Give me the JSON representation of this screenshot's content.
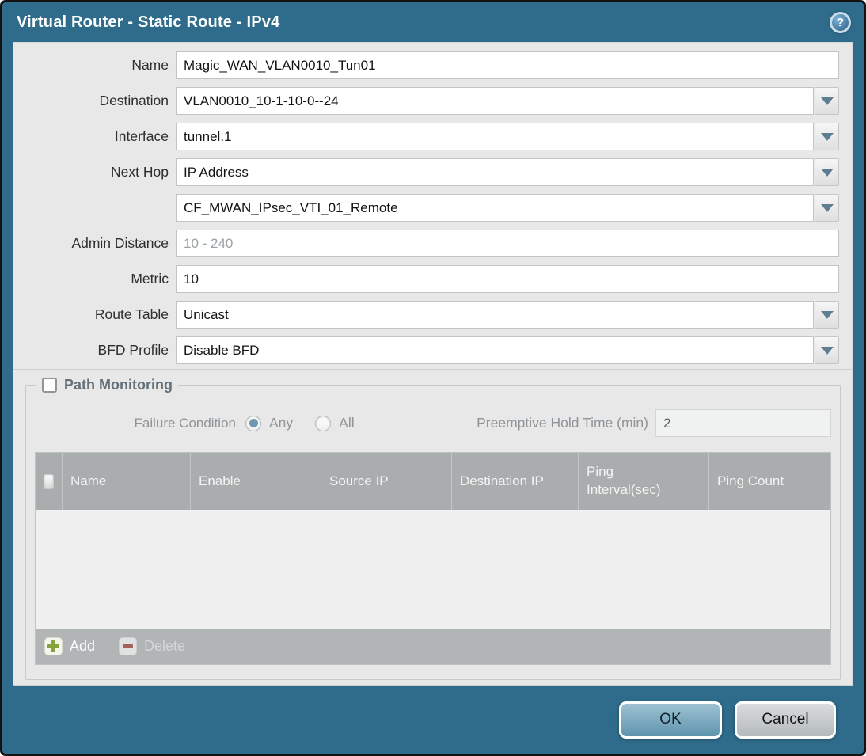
{
  "dialog": {
    "title": "Virtual Router - Static Route - IPv4",
    "icons": {
      "help_icon": "question-mark-circle",
      "help_glyph": "?",
      "dropdown_icon": "chevron-down-triangle",
      "add_icon": "green-plus",
      "delete_icon": "red-minus"
    },
    "colors": {
      "titlebar_teal": "#2f6c8b",
      "content_bg": "#e8e8e8",
      "table_header_bg": "#a9adad",
      "toolbar_bg": "#b1b5b5",
      "ok_button": "#6f9fb8",
      "cancel_button": "#bdc1c4",
      "selected_radio": "#6e99ad",
      "add_plus_green": "#86a23c",
      "delete_minus_red": "#a4544e"
    }
  },
  "form": {
    "name": {
      "label": "Name",
      "value": "Magic_WAN_VLAN0010_Tun01"
    },
    "destination": {
      "label": "Destination",
      "value": "VLAN0010_10-1-10-0--24"
    },
    "interface": {
      "label": "Interface",
      "value": "tunnel.1"
    },
    "next_hop": {
      "label": "Next Hop",
      "value": "IP Address"
    },
    "next_hop_address": {
      "value": "CF_MWAN_IPsec_VTI_01_Remote"
    },
    "admin_distance": {
      "label": "Admin Distance",
      "value": "",
      "placeholder": "10 - 240"
    },
    "metric": {
      "label": "Metric",
      "value": "10"
    },
    "route_table": {
      "label": "Route Table",
      "value": "Unicast"
    },
    "bfd_profile": {
      "label": "BFD Profile",
      "value": "Disable BFD"
    }
  },
  "path_monitoring": {
    "title": "Path Monitoring",
    "enabled": false,
    "failure_condition": {
      "label": "Failure Condition",
      "options": [
        {
          "label": "Any",
          "selected": true
        },
        {
          "label": "All",
          "selected": false
        }
      ]
    },
    "preemptive_hold_time": {
      "label": "Preemptive Hold Time (min)",
      "value": "2"
    },
    "table": {
      "columns": [
        "Name",
        "Enable",
        "Source IP",
        "Destination IP",
        "Ping Interval(sec)",
        "Ping Count"
      ],
      "rows": []
    },
    "toolbar": {
      "add_label": "Add",
      "delete_label": "Delete",
      "delete_disabled": true
    }
  },
  "footer": {
    "ok_label": "OK",
    "cancel_label": "Cancel"
  }
}
